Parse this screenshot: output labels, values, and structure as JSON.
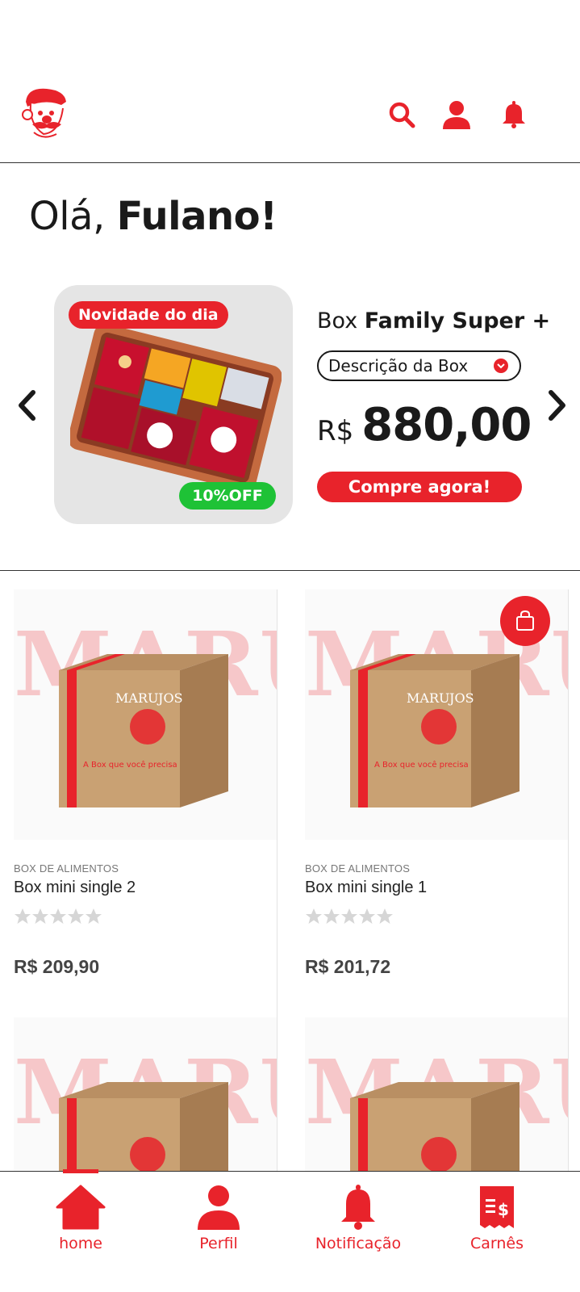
{
  "header": {
    "logo": "marujos-captain-logo",
    "icons": [
      "search-icon",
      "user-icon",
      "bell-icon"
    ]
  },
  "greeting": {
    "prefix": "Olá,",
    "name": "Fulano!"
  },
  "featured": {
    "badge_new": "Novidade do dia",
    "badge_discount": "10%OFF",
    "title_prefix": "Box",
    "title_bold": "Family Super +",
    "description_select": "Descrição da Box",
    "currency": "R$",
    "price": "880,00",
    "buy_label": "Compre agora!"
  },
  "products": [
    {
      "category": "BOX DE ALIMENTOS",
      "name": "Box mini single 2",
      "rating": 0,
      "price": "R$ 209,90"
    },
    {
      "category": "BOX DE ALIMENTOS",
      "name": "Box mini single 1",
      "rating": 0,
      "price": "R$ 201,72"
    }
  ],
  "bottom_nav": {
    "active": "home",
    "items": [
      {
        "label": "home",
        "icon": "home-icon"
      },
      {
        "label": "Perfil",
        "icon": "user-icon"
      },
      {
        "label": "Notificação",
        "icon": "bell-icon"
      },
      {
        "label": "Carnês",
        "icon": "receipt-icon"
      }
    ]
  },
  "colors": {
    "accent": "#e8232b",
    "discount": "#1ec236",
    "card_bg": "#e5e5e5",
    "text": "#1a1a1a"
  }
}
